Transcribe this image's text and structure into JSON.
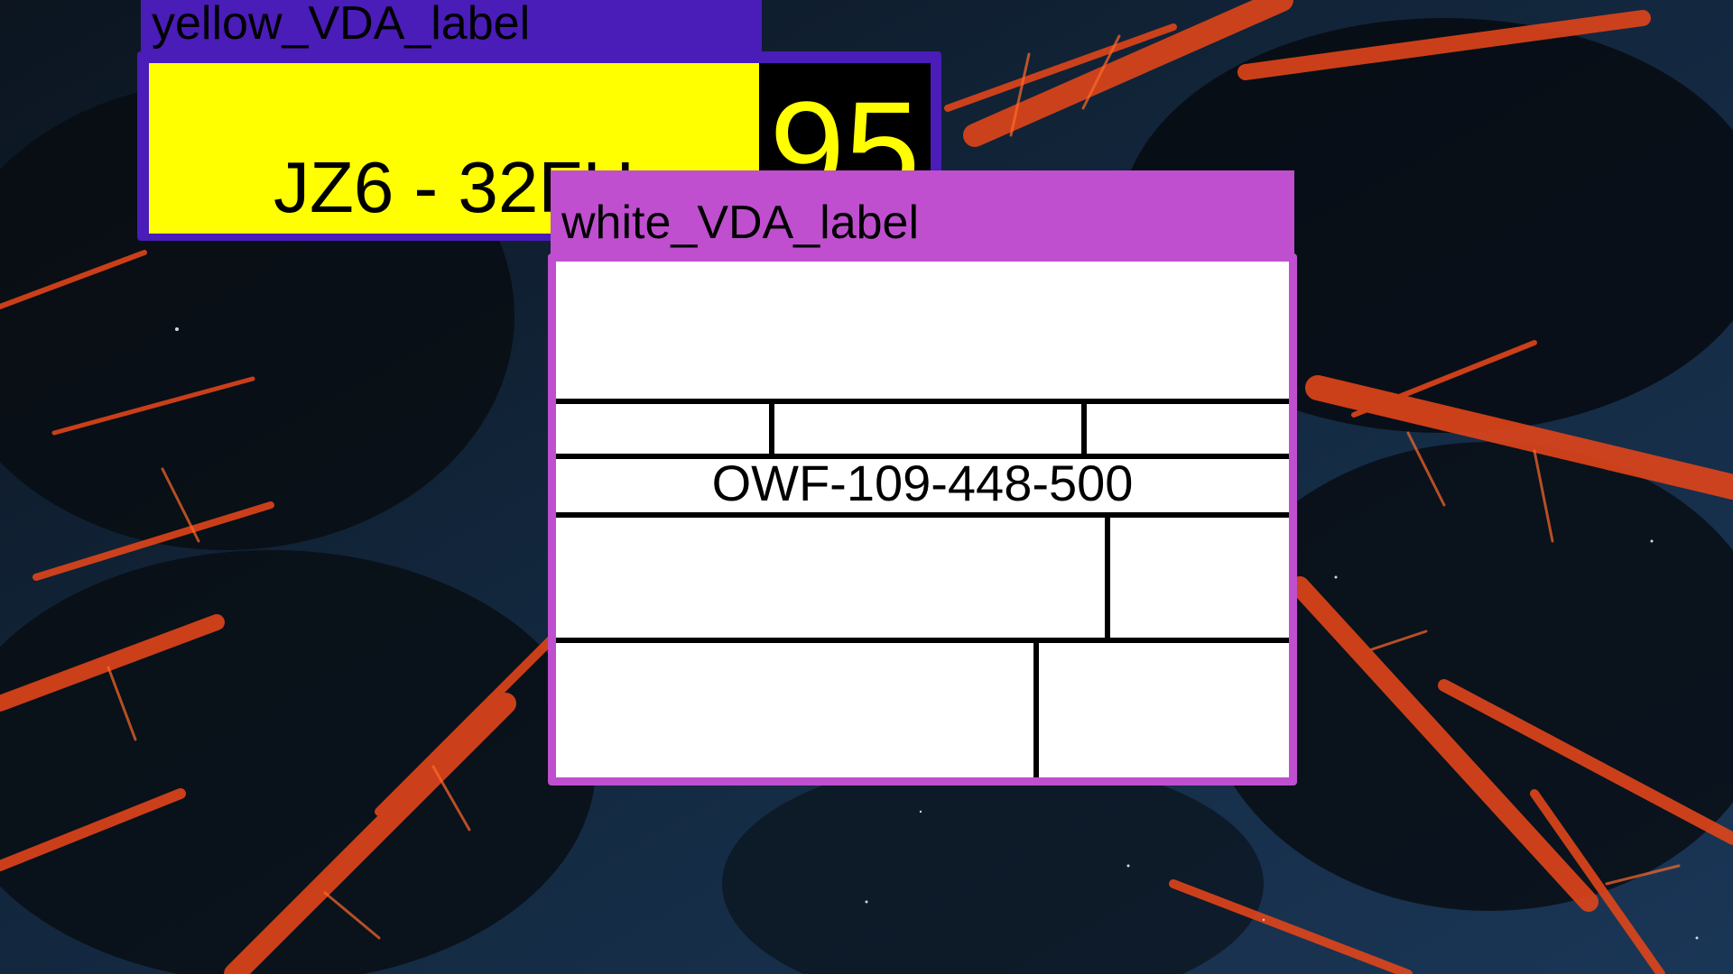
{
  "colors": {
    "yellow_window_frame": "#4a1cb8",
    "white_window_frame": "#bf4fcf",
    "plate_yellow": "#ffff00",
    "score_background": "#000000",
    "score_text": "#ffff00",
    "label_white": "#ffffff"
  },
  "yellow_window": {
    "title": "yellow_VDA_label",
    "plate_text": "JZ6 - 32FH",
    "score": "95"
  },
  "white_window": {
    "title": "white_VDA_label",
    "part_number": "OWF-109-448-500"
  }
}
